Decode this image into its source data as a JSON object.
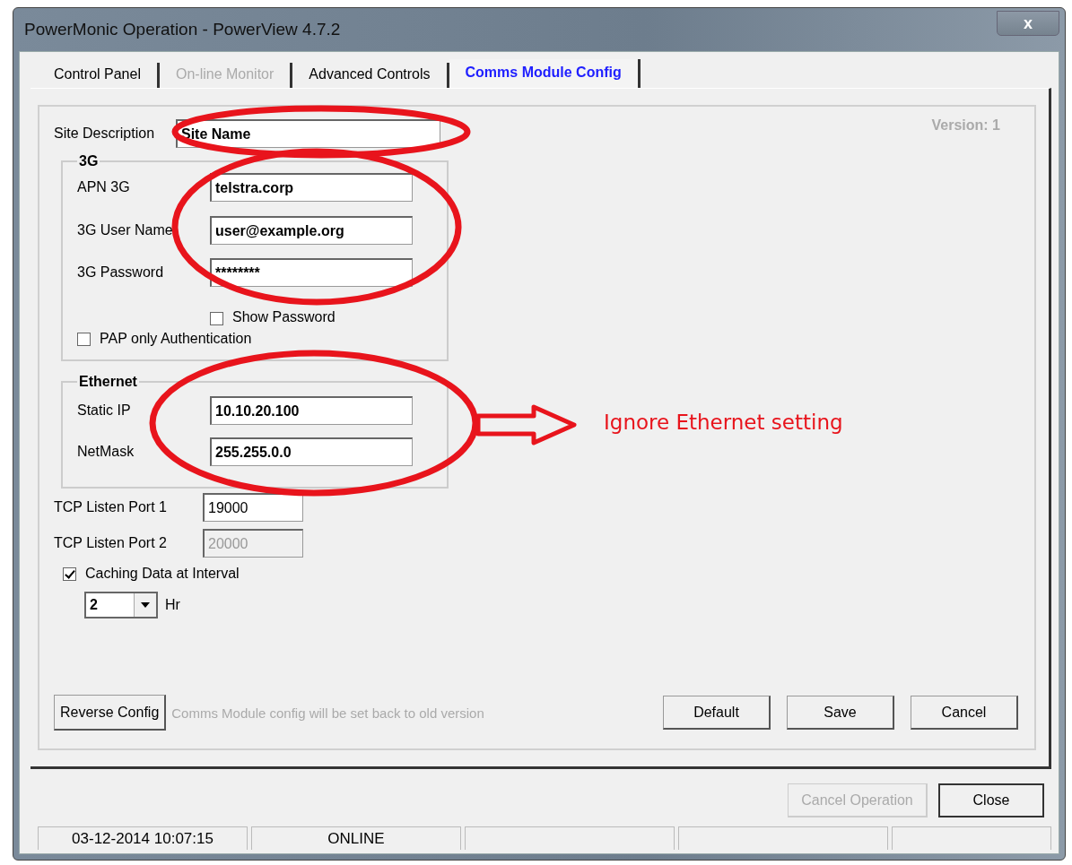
{
  "window": {
    "title": "PowerMonic Operation - PowerView 4.7.2",
    "close": "x"
  },
  "tabs": [
    {
      "label": "Control Panel",
      "selected": false,
      "disabled": false
    },
    {
      "label": "On-line Monitor",
      "selected": false,
      "disabled": true
    },
    {
      "label": "Advanced Controls",
      "selected": false,
      "disabled": false
    },
    {
      "label": "Comms Module Config",
      "selected": true,
      "disabled": false
    }
  ],
  "version": "Version: 1",
  "site_description": {
    "label": "Site Description",
    "value": "Site Name"
  },
  "group_3g": {
    "title": "3G",
    "fields": [
      {
        "label": "APN 3G",
        "value": "telstra.corp"
      },
      {
        "label": "3G User Name",
        "value": "user@example.org"
      },
      {
        "label": "3G Password",
        "value": "********"
      }
    ],
    "show_password": {
      "label": "Show Password",
      "checked": false
    },
    "pap": {
      "label": "PAP only Authentication",
      "checked": false
    }
  },
  "ethernet": {
    "title": "Ethernet",
    "fields": [
      {
        "label": "Static IP",
        "value": "10.10.20.100"
      },
      {
        "label": "NetMask",
        "value": "255.255.0.0"
      }
    ]
  },
  "tcp_ports": [
    {
      "label": "TCP Listen Port 1",
      "value": "19000",
      "disabled": false
    },
    {
      "label": "TCP Listen Port 2",
      "value": "20000",
      "disabled": true
    }
  ],
  "caching": {
    "label": "Caching Data at Interval",
    "checked": true
  },
  "interval": {
    "value": "2",
    "unit": "Hr"
  },
  "reverse": {
    "button": "Reverse Config",
    "note": "Comms Module config will be set back to old version"
  },
  "buttons": [
    "Default",
    "Save",
    "Cancel"
  ],
  "footer_buttons": [
    {
      "label": "Cancel Operation",
      "disabled": true
    },
    {
      "label": "Close",
      "disabled": false
    }
  ],
  "status_bar": [
    "03-12-2014 10:07:15",
    "ONLINE"
  ],
  "annotation": {
    "text": "Ignore Ethernet setting"
  }
}
